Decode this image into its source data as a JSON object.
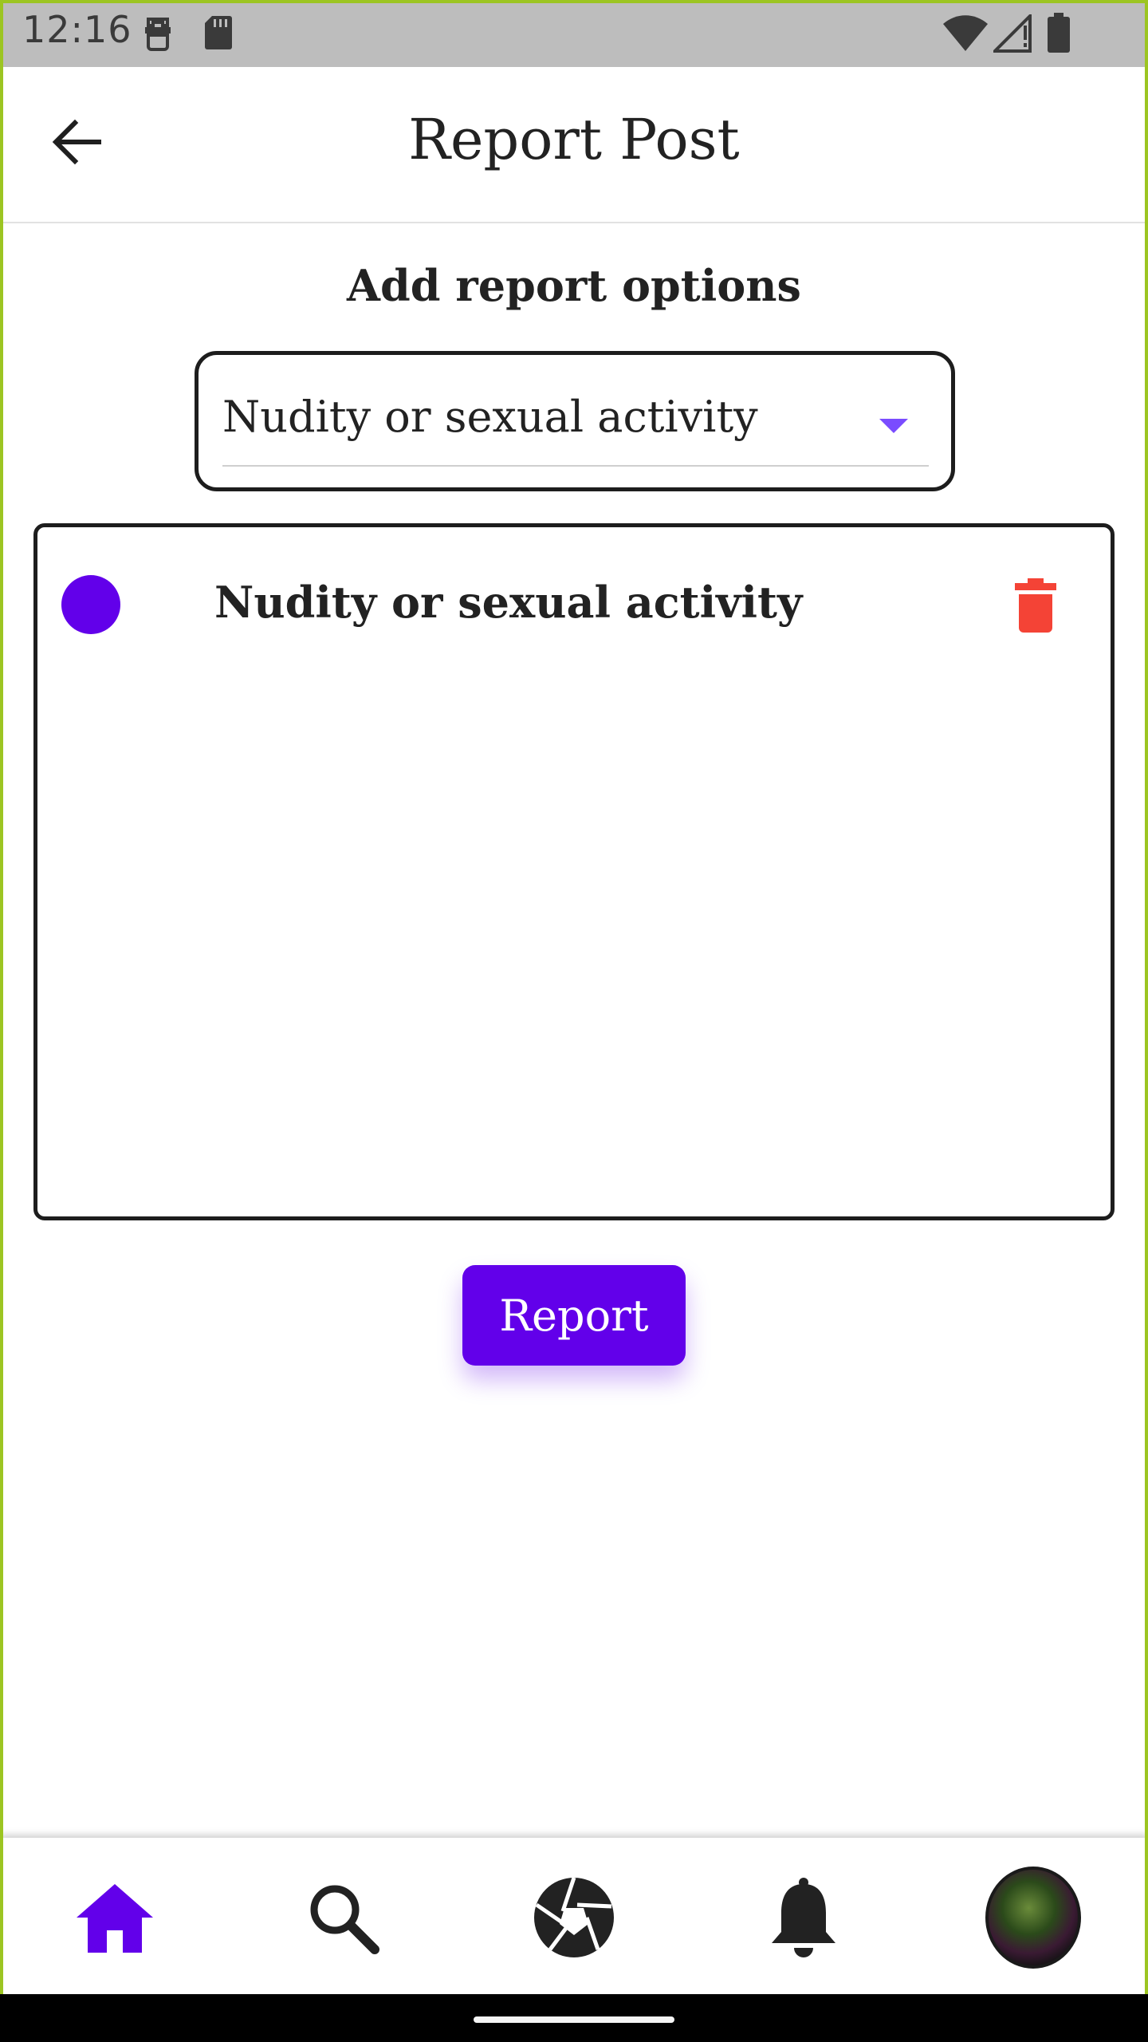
{
  "status_bar": {
    "time": "12:16",
    "icons": [
      "face-icon",
      "sd-card-icon",
      "wifi-icon",
      "signal-icon",
      "battery-icon"
    ]
  },
  "app_bar": {
    "title": "Report Post",
    "back_icon": "arrow-back-icon"
  },
  "report_form": {
    "heading": "Add report options",
    "dropdown": {
      "selected": "Nudity or sexual activity",
      "caret_icon": "arrow-drop-down-icon"
    },
    "selected_options": [
      {
        "label": "Nudity or sexual activity",
        "dot_color": "#6200ea",
        "delete_icon": "trash-icon"
      }
    ],
    "submit_label": "Report"
  },
  "bottom_nav": {
    "items": [
      {
        "name": "home",
        "icon": "home-icon",
        "active": true
      },
      {
        "name": "search",
        "icon": "search-icon",
        "active": false
      },
      {
        "name": "camera",
        "icon": "aperture-icon",
        "active": false
      },
      {
        "name": "notifications",
        "icon": "bell-icon",
        "active": false
      },
      {
        "name": "profile",
        "icon": "avatar",
        "active": false
      }
    ]
  },
  "colors": {
    "accent": "#6200ea",
    "delete": "#f44336",
    "status_bar_bg": "#bdbdbd",
    "frame_border": "#9cc522"
  }
}
